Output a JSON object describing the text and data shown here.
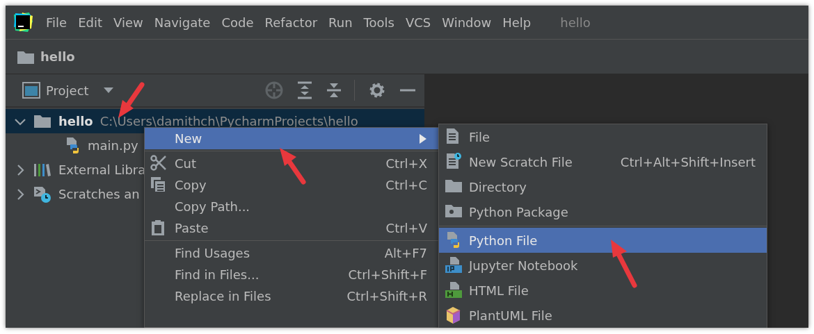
{
  "window": {
    "title": "hello"
  },
  "menu_bar": [
    {
      "label": "File"
    },
    {
      "label": "Edit"
    },
    {
      "label": "View"
    },
    {
      "label": "Navigate"
    },
    {
      "label": "Code"
    },
    {
      "label": "Refactor"
    },
    {
      "label": "Run"
    },
    {
      "label": "Tools"
    },
    {
      "label": "VCS"
    },
    {
      "label": "Window"
    },
    {
      "label": "Help"
    }
  ],
  "navigation_bar": {
    "label": "hello"
  },
  "tool_window": {
    "title": "Project"
  },
  "project_tree": [
    {
      "label": "hello",
      "path": "C:\\Users\\damithch\\PycharmProjects\\hello",
      "expanded": true,
      "selected": true,
      "children": [
        {
          "label": "main.py",
          "selected": false
        }
      ]
    },
    {
      "label": "External Libra",
      "expanded": false,
      "selected": false
    },
    {
      "label": "Scratches an",
      "expanded": false,
      "selected": false
    }
  ],
  "context_menu": [
    {
      "kind": "item",
      "label": "New",
      "has_submenu": true,
      "selected": true
    },
    {
      "kind": "separator"
    },
    {
      "kind": "item",
      "label": "Cut",
      "shortcut": "Ctrl+X",
      "selected": false
    },
    {
      "kind": "item",
      "label": "Copy",
      "shortcut": "Ctrl+C",
      "selected": false
    },
    {
      "kind": "item",
      "label": "Copy Path...",
      "selected": false
    },
    {
      "kind": "item",
      "label": "Paste",
      "shortcut": "Ctrl+V",
      "selected": false
    },
    {
      "kind": "separator"
    },
    {
      "kind": "item",
      "label": "Find Usages",
      "shortcut": "Alt+F7",
      "selected": false
    },
    {
      "kind": "item",
      "label": "Find in Files...",
      "shortcut": "Ctrl+Shift+F",
      "selected": false
    },
    {
      "kind": "item",
      "label": "Replace in Files",
      "shortcut": "Ctrl+Shift+R",
      "selected": false
    }
  ],
  "submenu": [
    {
      "kind": "item",
      "label": "File",
      "selected": false
    },
    {
      "kind": "item",
      "label": "New Scratch File",
      "shortcut": "Ctrl+Alt+Shift+Insert",
      "selected": false
    },
    {
      "kind": "item",
      "label": "Directory",
      "selected": false
    },
    {
      "kind": "item",
      "label": "Python Package",
      "selected": false
    },
    {
      "kind": "separator"
    },
    {
      "kind": "item",
      "label": "Python File",
      "selected": true
    },
    {
      "kind": "item",
      "label": "Jupyter Notebook",
      "selected": false
    },
    {
      "kind": "item",
      "label": "HTML File",
      "selected": false
    },
    {
      "kind": "item",
      "label": "PlantUML File",
      "selected": false
    }
  ]
}
